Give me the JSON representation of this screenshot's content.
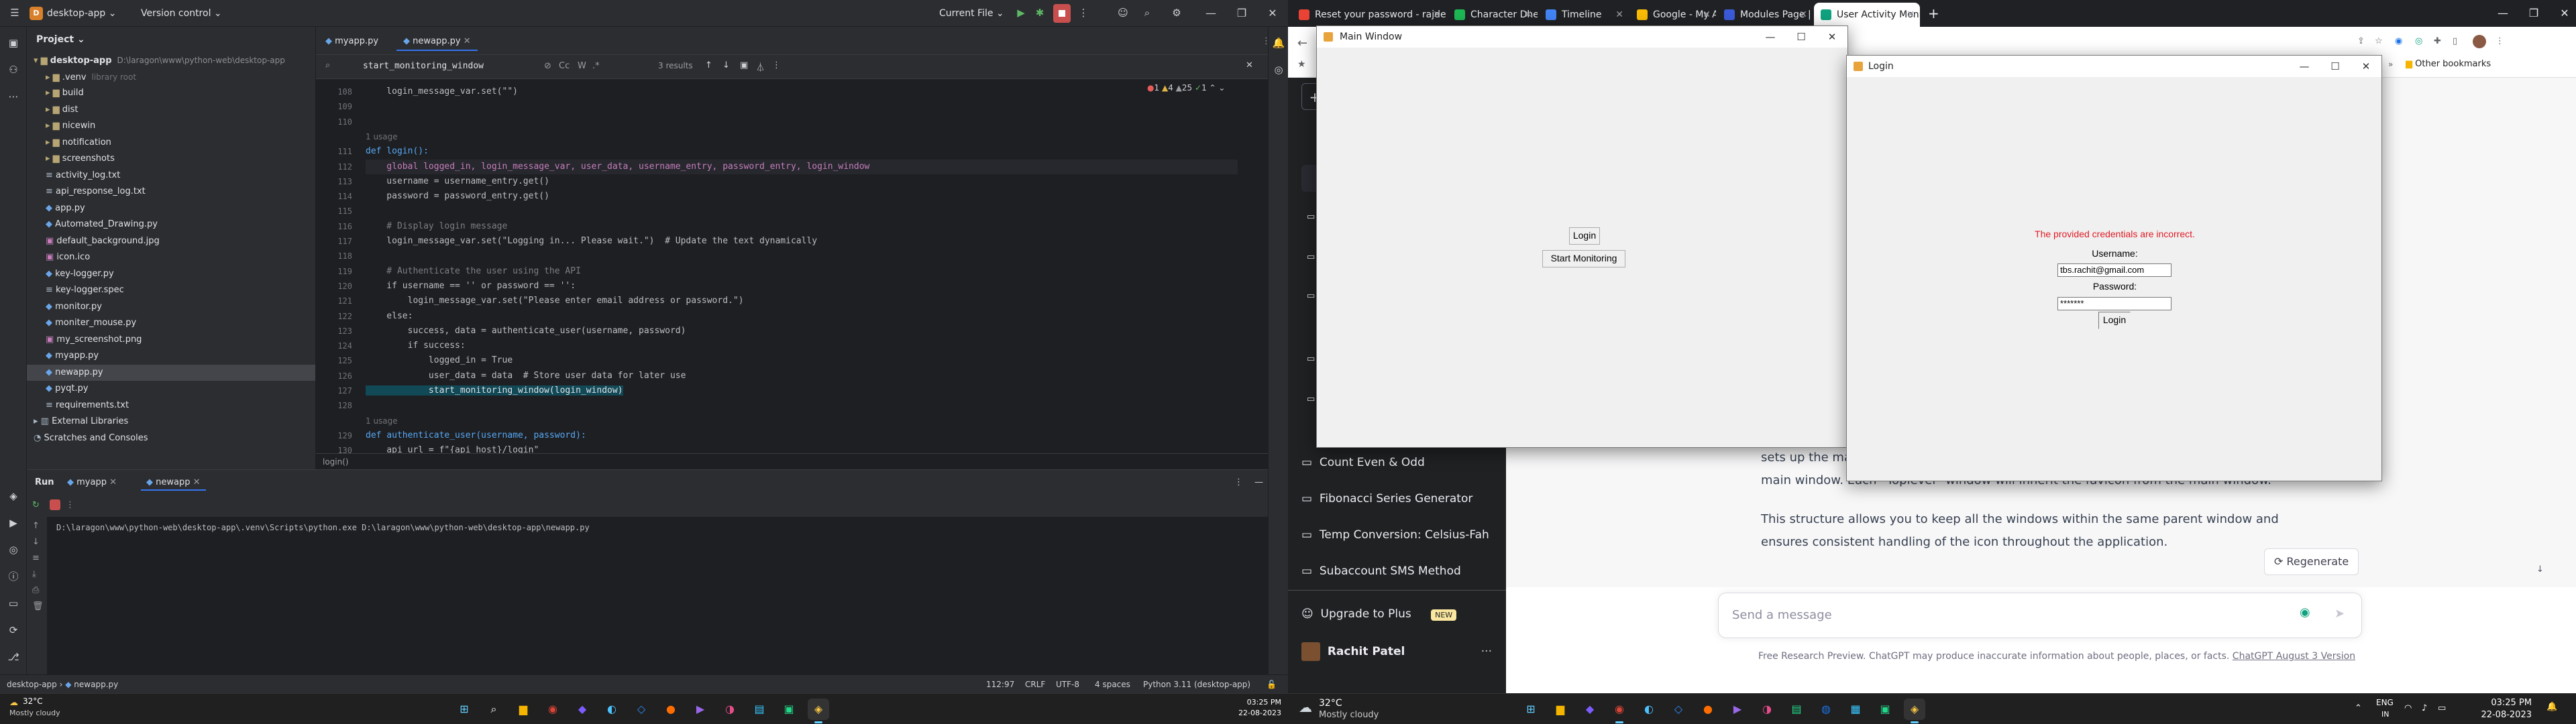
{
  "ide": {
    "project_name": "desktop-app",
    "project_badge": "D",
    "version_control": "Version control",
    "run_config": "Current File",
    "project_panel_title": "Project",
    "tree": [
      {
        "label": "desktop-app",
        "suffix": "D:\\laragon\\www\\python-web\\desktop-app",
        "kind": "folder",
        "indent": 0
      },
      {
        "label": ".venv",
        "suffix": "library root",
        "kind": "folder",
        "indent": 1
      },
      {
        "label": "build",
        "suffix": "",
        "kind": "folder",
        "indent": 1
      },
      {
        "label": "dist",
        "suffix": "",
        "kind": "folder",
        "indent": 1
      },
      {
        "label": "nicewin",
        "suffix": "",
        "kind": "folder",
        "indent": 1
      },
      {
        "label": "notification",
        "suffix": "",
        "kind": "folder",
        "indent": 1
      },
      {
        "label": "screenshots",
        "suffix": "",
        "kind": "folder",
        "indent": 1
      },
      {
        "label": "activity_log.txt",
        "suffix": "",
        "kind": "text",
        "indent": 1
      },
      {
        "label": "api_response_log.txt",
        "suffix": "",
        "kind": "text",
        "indent": 1
      },
      {
        "label": "app.py",
        "suffix": "",
        "kind": "python",
        "indent": 1
      },
      {
        "label": "Automated_Drawing.py",
        "suffix": "",
        "kind": "python",
        "indent": 1
      },
      {
        "label": "default_background.jpg",
        "suffix": "",
        "kind": "image",
        "indent": 1
      },
      {
        "label": "icon.ico",
        "suffix": "",
        "kind": "image",
        "indent": 1
      },
      {
        "label": "key-logger.py",
        "suffix": "",
        "kind": "python",
        "indent": 1
      },
      {
        "label": "key-logger.spec",
        "suffix": "",
        "kind": "text",
        "indent": 1
      },
      {
        "label": "monitor.py",
        "suffix": "",
        "kind": "python",
        "indent": 1
      },
      {
        "label": "moniter_mouse.py",
        "suffix": "",
        "kind": "python",
        "indent": 1
      },
      {
        "label": "my_screenshot.png",
        "suffix": "",
        "kind": "image",
        "indent": 1
      },
      {
        "label": "myapp.py",
        "suffix": "",
        "kind": "python",
        "indent": 1
      },
      {
        "label": "newapp.py",
        "suffix": "",
        "kind": "python",
        "indent": 1,
        "selected": true
      },
      {
        "label": "pyqt.py",
        "suffix": "",
        "kind": "python",
        "indent": 1
      },
      {
        "label": "requirements.txt",
        "suffix": "",
        "kind": "text",
        "indent": 1
      },
      {
        "label": "External Libraries",
        "suffix": "",
        "kind": "lib",
        "indent": 0
      },
      {
        "label": "Scratches and Consoles",
        "suffix": "",
        "kind": "scratch",
        "indent": 0
      }
    ],
    "editor_tabs": [
      "myapp.py",
      "newapp.py"
    ],
    "find": {
      "query": "start_monitoring_window",
      "results": "3 results",
      "opt1": "Cc",
      "opt2": "W",
      "opt3": ".*"
    },
    "inspections": {
      "errors": "1",
      "warnings": "4",
      "weak": "25",
      "typos": "1"
    },
    "code": [
      {
        "n": "108",
        "t": "    login_message_var.set(\"\")",
        "kind": "plain"
      },
      {
        "n": "109",
        "t": "",
        "kind": "plain"
      },
      {
        "n": "110",
        "t": "",
        "kind": "plain"
      },
      {
        "n": "",
        "t": "1 usage",
        "kind": "usage"
      },
      {
        "n": "111",
        "t": "def login():",
        "kind": "def"
      },
      {
        "n": "112",
        "t": "    global logged_in, login_message_var, user_data, username_entry, password_entry, login_window",
        "kind": "global",
        "hl": true
      },
      {
        "n": "113",
        "t": "    username = username_entry.get()",
        "kind": "plain"
      },
      {
        "n": "114",
        "t": "    password = password_entry.get()",
        "kind": "plain"
      },
      {
        "n": "115",
        "t": "",
        "kind": "plain"
      },
      {
        "n": "116",
        "t": "    # Display login message",
        "kind": "comment"
      },
      {
        "n": "117",
        "t": "    login_message_var.set(\"Logging in... Please wait.\")  # Update the text dynamically",
        "kind": "plain"
      },
      {
        "n": "118",
        "t": "",
        "kind": "plain"
      },
      {
        "n": "119",
        "t": "    # Authenticate the user using the API",
        "kind": "comment"
      },
      {
        "n": "120",
        "t": "    if username == '' or password == '':",
        "kind": "plain"
      },
      {
        "n": "121",
        "t": "        login_message_var.set(\"Please enter email address or password.\")",
        "kind": "plain"
      },
      {
        "n": "122",
        "t": "    else:",
        "kind": "plain"
      },
      {
        "n": "123",
        "t": "        success, data = authenticate_user(username, password)",
        "kind": "plain"
      },
      {
        "n": "124",
        "t": "        if success:",
        "kind": "plain"
      },
      {
        "n": "125",
        "t": "            logged_in = True",
        "kind": "plain"
      },
      {
        "n": "126",
        "t": "            user_data = data  # Store user data for later use",
        "kind": "plain"
      },
      {
        "n": "127",
        "t": "            start_monitoring_window(login_window)",
        "kind": "match"
      },
      {
        "n": "128",
        "t": "",
        "kind": "plain"
      },
      {
        "n": "",
        "t": "1 usage",
        "kind": "usage"
      },
      {
        "n": "129",
        "t": "def authenticate_user(username, password):",
        "kind": "def"
      },
      {
        "n": "130",
        "t": "    api_url = f\"{api_host}/login\"",
        "kind": "plain"
      }
    ],
    "breadcrumb": "login()",
    "run": {
      "label": "Run",
      "tabs": [
        "myapp",
        "newapp"
      ],
      "command": "D:\\laragon\\www\\python-web\\desktop-app\\.venv\\Scripts\\python.exe D:\\laragon\\www\\python-web\\desktop-app\\newapp.py"
    },
    "status": {
      "path_root": "desktop-app",
      "path_file": "newapp.py",
      "position": "112:97",
      "line_sep": "CRLF",
      "encoding": "UTF-8",
      "indent": "4 spaces",
      "interpreter": "Python 3.11 (desktop-app)"
    }
  },
  "taskbar_left": {
    "weather_temp": "32°C",
    "weather_desc": "Mostly cloudy",
    "time": "03:25 PM",
    "date": "22-08-2023"
  },
  "taskbar_right": {
    "weather_temp": "32°C",
    "weather_desc": "Mostly cloudy",
    "lang": "ENG",
    "lang_sub": "IN",
    "time": "03:25 PM",
    "date": "22-08-2023"
  },
  "browser": {
    "tabs": [
      {
        "label": "Reset your password - rajde",
        "color": "#ea4335"
      },
      {
        "label": "Character Dheela - Pritam",
        "color": "#1db954"
      },
      {
        "label": "Timeline",
        "color": "#4285f4"
      },
      {
        "label": "Google - My Activity",
        "color": "#fbbc04"
      },
      {
        "label": "Modules Page | Learner",
        "color": "#3b5bdb"
      },
      {
        "label": "User Activity Monitoring",
        "color": "#10a37f",
        "active": true
      }
    ],
    "other_bookmarks": "Other bookmarks",
    "sidebar_items": [
      "Count Even & Odd",
      "Fibonacci Series Generator",
      "Temp Conversion: Celsius-Fah",
      "Subaccount SMS Method"
    ],
    "upgrade": "Upgrade to Plus",
    "upgrade_badge": "NEW",
    "user_name": "Rachit Patel",
    "chat_text_1": "sets up the ma",
    "chat_text_2": "main window. Each `Toplevel` window will inherit the favicon from the main window.",
    "chat_text_3": "This structure allows you to keep all the windows within the same parent window and",
    "chat_text_4": "ensures consistent handling of the icon throughout the application.",
    "regenerate": "Regenerate",
    "message_placeholder": "Send a message",
    "footer_text": "Free Research Preview. ChatGPT may produce inaccurate information about people, places, or facts.",
    "footer_link": "ChatGPT August 3 Version"
  },
  "main_window": {
    "title": "Main Window",
    "login_button": "Login",
    "start_button": "Start Monitoring"
  },
  "login_window": {
    "title": "Login",
    "error": "The provided credentials are incorrect.",
    "username_label": "Username:",
    "username_value": "tbs.rachit@gmail.com",
    "password_label": "Password:",
    "password_value": "*******",
    "login_button": "Login"
  },
  "colors": {
    "error_red": "#e01b24",
    "accent_blue": "#3574f0",
    "chatgpt_green": "#10a37f"
  }
}
